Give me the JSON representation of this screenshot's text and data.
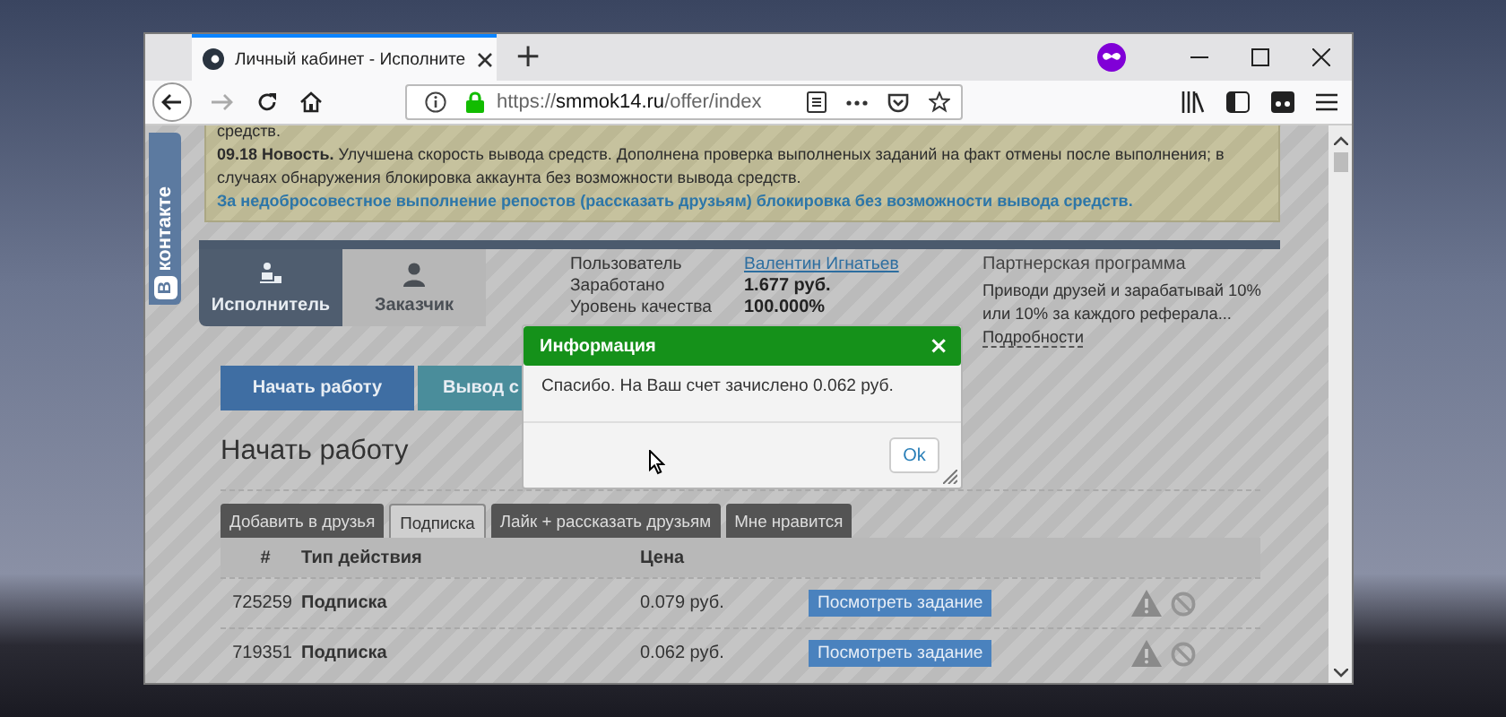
{
  "browser": {
    "tab_title": "Личный кабинет - Исполните",
    "new_tab": "+",
    "url_parts": [
      "https://",
      "smmok14.ru",
      "/offer/index"
    ],
    "forward_disabled": true
  },
  "vk_widget": {
    "badge": "В",
    "text": "контакте"
  },
  "news": [
    {
      "kind": "text",
      "text": "средств."
    },
    {
      "kind": "text",
      "text": "**09.18 Новость.** Улучшена скорость вывода средств. Дополнена проверка выполненых заданий на факт отмены после выполнения; в случаях обнаружения блокировка аккаунта без возможности вывода средств."
    },
    {
      "kind": "link",
      "text": "За недобросовестное выполнение репостов (рассказать друзьям) блокировка без возможности вывода средств."
    }
  ],
  "profile": {
    "tabs": [
      {
        "label": "Исполнитель",
        "selected": true
      },
      {
        "label": "Заказчик",
        "selected": false
      }
    ],
    "stats": [
      {
        "label": "Пользователь",
        "value": "Валентин Игнатьев",
        "kind": "link"
      },
      {
        "label": "Заработано",
        "value": "1.677 руб.",
        "kind": "bold"
      },
      {
        "label": "Уровень качества",
        "value": "100.000%",
        "kind": "bold"
      }
    ],
    "partner": {
      "title": "Партнерская программа",
      "text": "Приводи друзей и зарабатывай 10% или 10% за каждого реферала...",
      "link": "Подробности"
    }
  },
  "actions": [
    {
      "label": "Начать работу",
      "kind": "primary"
    },
    {
      "label": "Вывод с",
      "kind": "secondary"
    }
  ],
  "section_title": "Начать работу",
  "task_tabs": [
    {
      "label": "Добавить в друзья",
      "selected": false
    },
    {
      "label": "Подписка",
      "selected": true
    },
    {
      "label": "Лайк + рассказать друзьям",
      "selected": false
    },
    {
      "label": "Мне нравится",
      "selected": false
    }
  ],
  "table": {
    "columns": [
      "#",
      "Тип действия",
      "Цена"
    ],
    "rows": [
      {
        "id": "725259",
        "type": "Подписка",
        "price": "0.079 руб.",
        "action": "Посмотреть задание"
      },
      {
        "id": "719351",
        "type": "Подписка",
        "price": "0.062 руб.",
        "action": "Посмотреть задание"
      }
    ]
  },
  "dialog": {
    "title": "Информация",
    "close": "×",
    "message": "Спасибо. На Ваш счет зачислено 0.062 руб.",
    "button": "Ok"
  }
}
